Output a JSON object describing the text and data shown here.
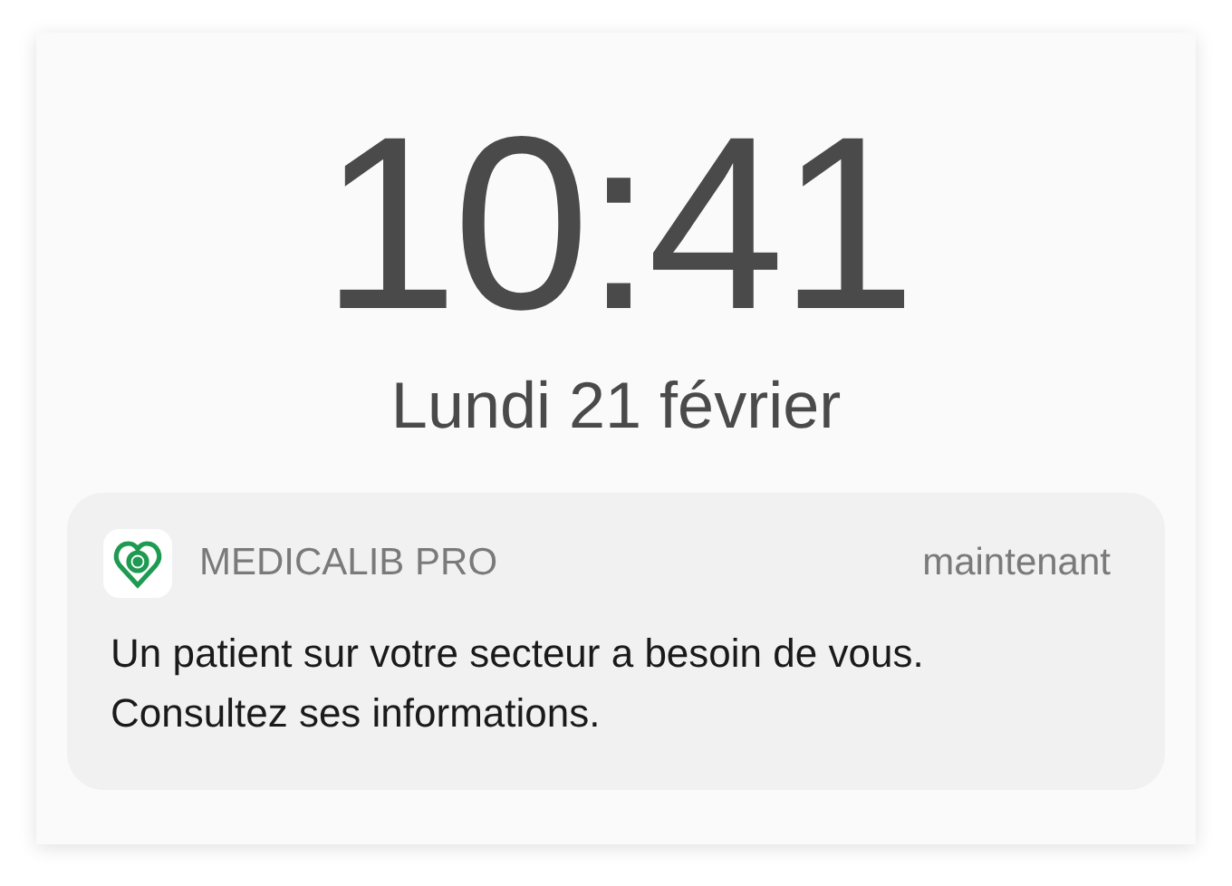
{
  "lock_screen": {
    "time": "10:41",
    "date": "Lundi 21 février"
  },
  "notification": {
    "app_name": "MEDICALIB PRO",
    "timestamp": "maintenant",
    "message": "Un patient sur votre secteur a besoin de vous. Consultez ses informations."
  }
}
